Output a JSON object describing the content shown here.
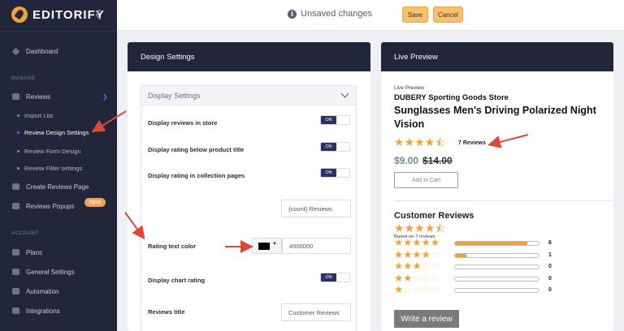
{
  "app": {
    "logo_text": "EDITORIFY"
  },
  "sidebar": {
    "dashboard": "Dashboard",
    "manage_head": "MANAGE",
    "reviews": "Reviews",
    "import_list": "Import List",
    "review_design_settings": "Review Design Settings",
    "review_form_design": "Review Form Design",
    "review_filter_settings": "Review Filter settings",
    "create_reviews_page": "Create Reviews Page",
    "reviews_popups": "Reviews Popups",
    "new_badge": "New",
    "account_head": "ACCOUNT",
    "plans": "Plans",
    "general_settings": "General Settings",
    "automation": "Automation",
    "integrations": "Integrations"
  },
  "topbar": {
    "unsaved": "Unsaved changes",
    "save": "Save",
    "cancel": "Cancel"
  },
  "design": {
    "card_title": "Design Settings",
    "panel_title": "Display Settings",
    "display_reviews_in_store": "Display reviews in store",
    "display_rating_below_title": "Display rating below product title",
    "display_rating_collection": "Display rating in collection pages",
    "toggle_on": "ON",
    "reviews_count_format": "{count} Reviews",
    "rating_text_color": "Rating text color",
    "rating_text_color_value": "#000000",
    "display_chart_rating": "Display chart rating",
    "reviews_title_label": "Reviews title",
    "reviews_title_value": "Customer Reviews"
  },
  "preview": {
    "card_title": "Live Preview",
    "small_label": "Live Preview",
    "store": "DUBERY Sporting Goods Store",
    "product_title": "Sunglasses Men's Driving Polarized Night Vision",
    "reviews_count": "7 Reviews",
    "price": "$9.00",
    "compare_price": "$14.00",
    "add_to_cart": "Add to Cart",
    "customer_reviews": "Customer Reviews",
    "based_on": "Based on 7 reviews",
    "rating": 4.5,
    "distribution": [
      {
        "stars": 5,
        "count": "6",
        "fraction": 0.86
      },
      {
        "stars": 4,
        "count": "1",
        "fraction": 0.14
      },
      {
        "stars": 3,
        "count": "0",
        "fraction": 0
      },
      {
        "stars": 2,
        "count": "0",
        "fraction": 0
      },
      {
        "stars": 1,
        "count": "0",
        "fraction": 0
      }
    ],
    "write_review": "Write a review"
  },
  "colors": {
    "sidebar_bg": "#22263a",
    "accent_orange": "#f0a23a",
    "toggle_on_bg": "#2c3160",
    "price_color": "#6d8f83",
    "annotation_arrow": "#e0473a"
  }
}
